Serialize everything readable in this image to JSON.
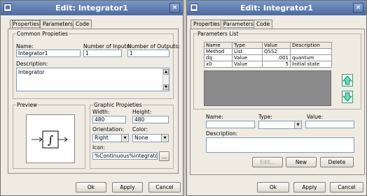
{
  "left_window": {
    "title": "Edit: Integrator1",
    "close_glyph": "×",
    "tabs": [
      "Properties",
      "Parameters",
      "Code"
    ],
    "common": {
      "legend": "Common Propieties",
      "name_label": "Name:",
      "name_value": "Integrator1",
      "inputs_label": "Number of Inputs:",
      "inputs_value": "1",
      "outputs_label": "Number of Outputs:",
      "outputs_value": "1",
      "description_label": "Description:",
      "description_value": "Integrator"
    },
    "preview": {
      "legend": "Preview"
    },
    "graphic": {
      "legend": "Graphic Propieties",
      "width_label": "Width:",
      "width_value": "480",
      "height_label": "Height:",
      "height_value": "480",
      "orientation_label": "Orientation:",
      "orientation_value": "Right",
      "color_label": "Color:",
      "color_value": "None",
      "icon_label": "Icon:",
      "icon_value": "%Continuous%integrator.bm",
      "browse_label": "..."
    },
    "buttons": {
      "ok": "Ok",
      "apply": "Apply",
      "cancel": "Cancel"
    }
  },
  "right_window": {
    "title": "Edit: Integrator1",
    "close_glyph": "×",
    "tabs": [
      "Properties",
      "Parameters",
      "Code"
    ],
    "params": {
      "legend": "Parameters List",
      "columns": [
        "Name",
        "Type",
        "Value",
        "Description"
      ],
      "rows": [
        [
          "Method",
          "List",
          "QSS2",
          ""
        ],
        [
          "dq",
          "Value",
          ".001",
          "quantum"
        ],
        [
          "x0",
          "Value",
          "5",
          "Initial state"
        ]
      ]
    },
    "editor": {
      "name_label": "Name:",
      "type_label": "Type:",
      "value_label": "Value:",
      "description_label": "Description:"
    },
    "action_buttons": {
      "edit": "Edit...",
      "new": "New",
      "delete": "Delete"
    },
    "buttons": {
      "ok": "Ok",
      "apply": "Apply",
      "cancel": "Cancel"
    }
  },
  "colors": {
    "titlebar": "#5a77ab",
    "window_bg": "#efebe3",
    "arrow_accent": "#1fae84",
    "table_empty": "#8b8b8b"
  },
  "icons": [
    "window-menu-icon",
    "close-icon",
    "integrator-symbol-icon",
    "arrow-up-icon",
    "arrow-down-icon",
    "chevron-down-icon"
  ]
}
